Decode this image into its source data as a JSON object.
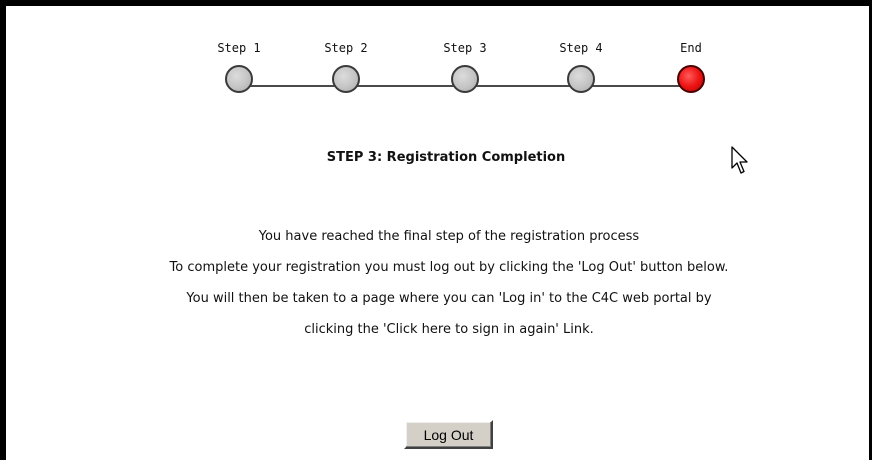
{
  "stepper": {
    "steps": [
      {
        "label": "Step 1",
        "state": "inactive"
      },
      {
        "label": "Step 2",
        "state": "inactive"
      },
      {
        "label": "Step 3",
        "state": "inactive"
      },
      {
        "label": "Step 4",
        "state": "inactive"
      },
      {
        "label": "End",
        "state": "active"
      }
    ],
    "colors": {
      "inactive": "#c4c4c4",
      "active": "#ee1515"
    }
  },
  "page": {
    "heading": "STEP 3: Registration Completion",
    "lines": [
      "You have reached the final step of the registration process",
      "To complete your registration you must log out by clicking the 'Log Out' button below.",
      "You will then be taken to a page where you can 'Log in' to the C4C web portal by",
      "clicking the 'Click here to sign in again' Link."
    ]
  },
  "actions": {
    "logout_label": "Log Out"
  },
  "icons": {
    "pointer": "mouse-pointer-icon"
  }
}
